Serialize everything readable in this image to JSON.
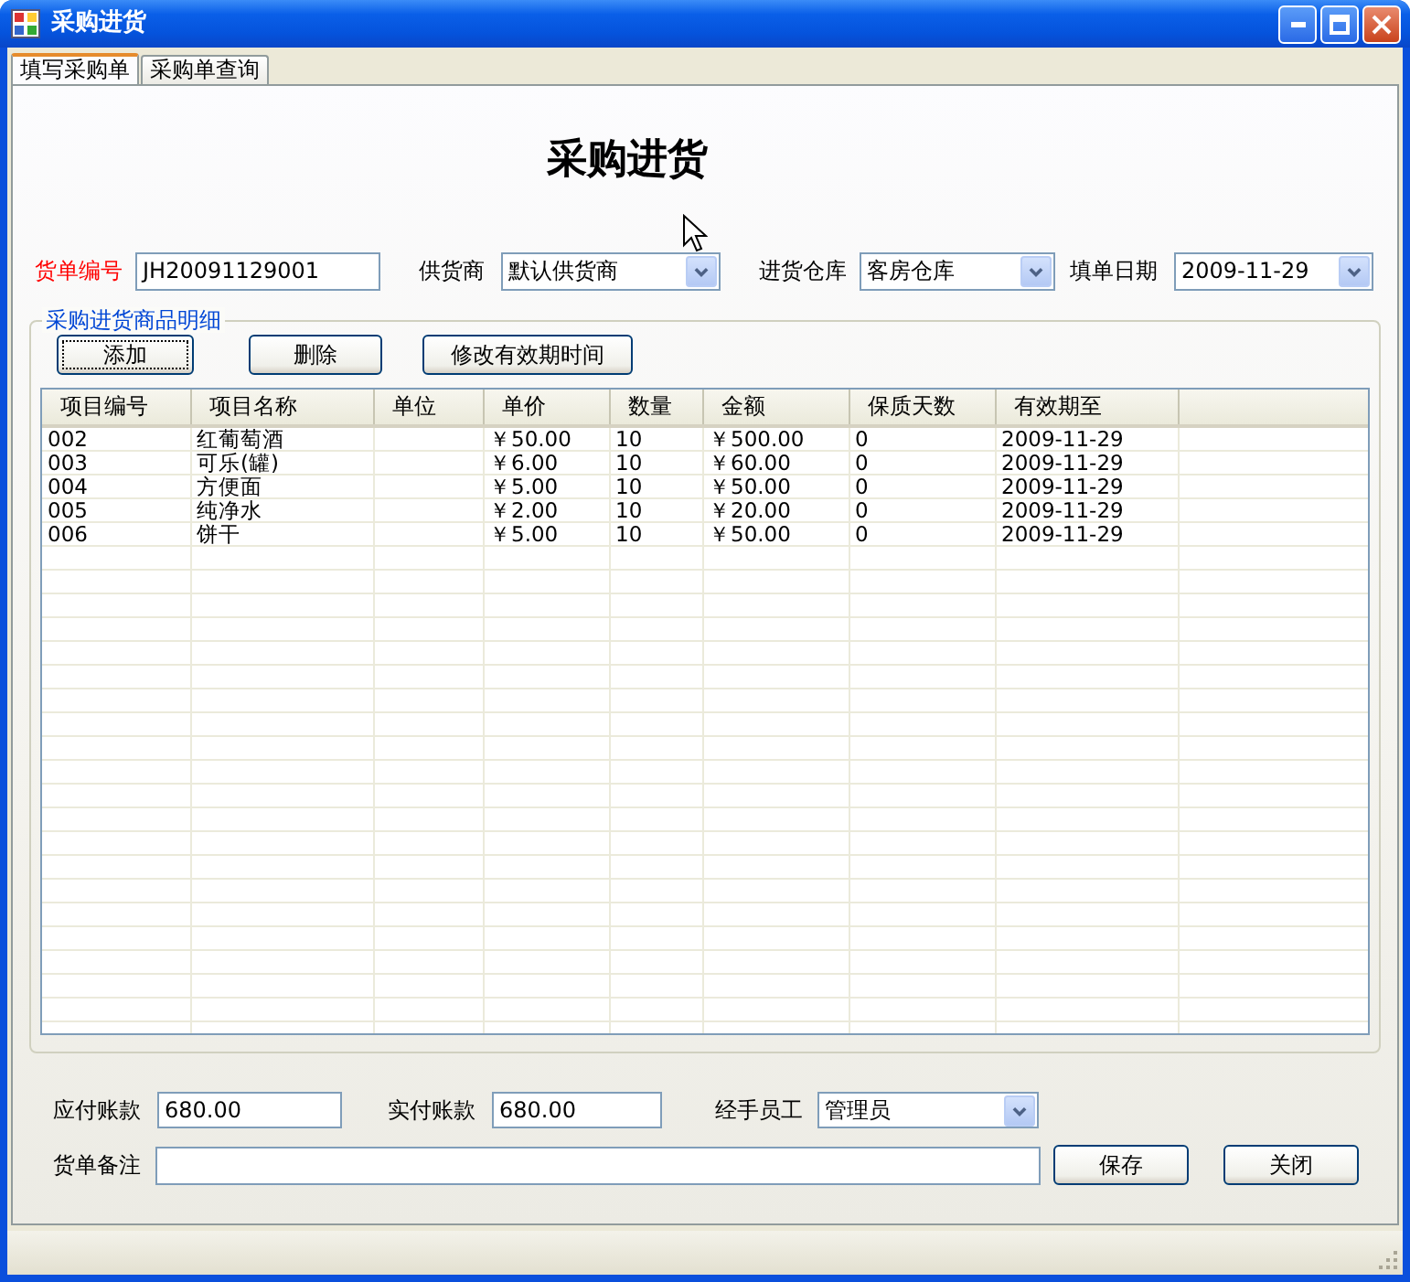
{
  "window": {
    "title": "采购进货"
  },
  "tabs": [
    {
      "label": "填写采购单",
      "selected": true
    },
    {
      "label": "采购单查询",
      "selected": false
    }
  ],
  "heading": "采购进货",
  "order_fields": [
    {
      "label": "货单编号",
      "kind": "text",
      "value": "JH20091129001",
      "required": true
    },
    {
      "label": "供货商",
      "kind": "select",
      "value": "默认供货商",
      "required": false
    },
    {
      "label": "进货仓库",
      "kind": "select",
      "value": "客房仓库",
      "required": false
    },
    {
      "label": "填单日期",
      "kind": "date",
      "value": "2009-11-29",
      "required": false
    }
  ],
  "details": {
    "title": "采购进货商品明细",
    "buttons": [
      {
        "label": "添加",
        "focused": true
      },
      {
        "label": "删除",
        "focused": false
      },
      {
        "label": "修改有效期时间",
        "focused": false
      }
    ],
    "table": {
      "columns": [
        "项目编号",
        "项目名称",
        "单位",
        "单价",
        "数量",
        "金额",
        "保质天数",
        "有效期至"
      ],
      "rows": [
        {
          "code": "002",
          "name": "红葡萄酒",
          "unit_price": "￥50.00",
          "quantity": "10",
          "amount": "￥500.00",
          "shelf_days": "0",
          "expiry": "2009-11-29"
        },
        {
          "code": "003",
          "name": "可乐(罐)",
          "unit_price": "￥6.00",
          "quantity": "10",
          "amount": "￥60.00",
          "shelf_days": "0",
          "expiry": "2009-11-29"
        },
        {
          "code": "004",
          "name": "方便面",
          "unit_price": "￥5.00",
          "quantity": "10",
          "amount": "￥50.00",
          "shelf_days": "0",
          "expiry": "2009-11-29"
        },
        {
          "code": "005",
          "name": "纯净水",
          "unit_price": "￥2.00",
          "quantity": "10",
          "amount": "￥20.00",
          "shelf_days": "0",
          "expiry": "2009-11-29"
        },
        {
          "code": "006",
          "name": "饼干",
          "unit_price": "￥5.00",
          "quantity": "10",
          "amount": "￥50.00",
          "shelf_days": "0",
          "expiry": "2009-11-29"
        }
      ]
    }
  },
  "footer": {
    "fields": [
      {
        "label": "应付账款",
        "kind": "text",
        "value": "680.00"
      },
      {
        "label": "实付账款",
        "kind": "text",
        "value": "680.00"
      },
      {
        "label": "经手员工",
        "kind": "select",
        "value": "管理员"
      }
    ],
    "remark": {
      "label": "货单备注"
    },
    "buttons": [
      {
        "label": "保存"
      },
      {
        "label": "关闭"
      }
    ]
  }
}
